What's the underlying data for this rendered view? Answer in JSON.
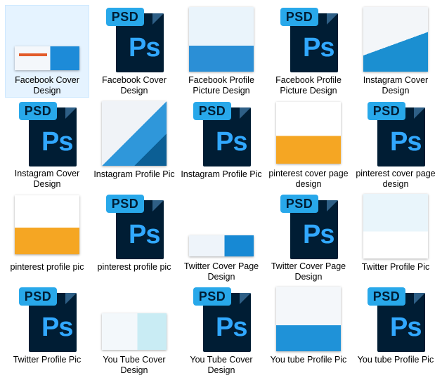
{
  "items": [
    {
      "label": "Facebook Cover Design",
      "type": "image",
      "thumb": "img-fb-cover",
      "selected": true
    },
    {
      "label": "Facebook Cover Design",
      "type": "psd"
    },
    {
      "label": "Facebook Profile Picture Design",
      "type": "image",
      "thumb": "img-fb-pic"
    },
    {
      "label": "Facebook Profile Picture Design",
      "type": "psd"
    },
    {
      "label": "Instagram Cover Design",
      "type": "image",
      "thumb": "img-ig-cover"
    },
    {
      "label": "Instagram Cover Design",
      "type": "psd"
    },
    {
      "label": "Instagram Profile Pic",
      "type": "image",
      "thumb": "img-ig-pic"
    },
    {
      "label": "Instagram Profile Pic",
      "type": "psd"
    },
    {
      "label": "pinterest cover page design",
      "type": "image",
      "thumb": "img-pin-cover"
    },
    {
      "label": "pinterest cover page design",
      "type": "psd"
    },
    {
      "label": "pinterest profile pic",
      "type": "image",
      "thumb": "img-pin-pic"
    },
    {
      "label": "pinterest profile pic",
      "type": "psd"
    },
    {
      "label": "Twitter Cover Page Design",
      "type": "image",
      "thumb": "img-tw-cover"
    },
    {
      "label": "Twitter Cover Page Design",
      "type": "psd"
    },
    {
      "label": "Twitter Profile Pic",
      "type": "image",
      "thumb": "img-tw-pic"
    },
    {
      "label": "Twitter Profile Pic",
      "type": "psd"
    },
    {
      "label": "You Tube Cover Design",
      "type": "image",
      "thumb": "img-yt-cover"
    },
    {
      "label": "You Tube Cover Design",
      "type": "psd"
    },
    {
      "label": "You tube Profile Pic",
      "type": "image",
      "thumb": "img-yt-pic"
    },
    {
      "label": "You tube Profile Pic",
      "type": "psd"
    }
  ],
  "psd_icon": {
    "tag_text": "PSD",
    "logo_text": "Ps",
    "tag_color": "#28a8ea",
    "page_color": "#001d34",
    "logo_color": "#31a8ff"
  },
  "selection_color": "#e5f3ff"
}
